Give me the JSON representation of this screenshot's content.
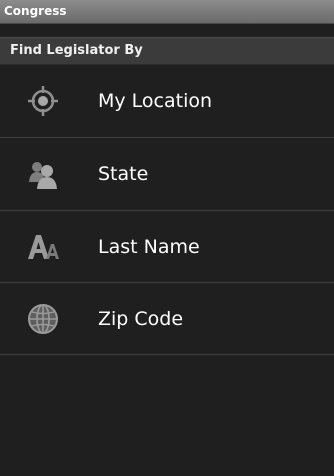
{
  "app": {
    "title": "Congress"
  },
  "section": {
    "header": "Find Legislator By"
  },
  "menu": {
    "items": [
      {
        "label": "My Location",
        "icon": "location-target-icon"
      },
      {
        "label": "State",
        "icon": "people-icon"
      },
      {
        "label": "Last Name",
        "icon": "letters-aa-icon"
      },
      {
        "label": "Zip Code",
        "icon": "globe-icon"
      }
    ]
  }
}
